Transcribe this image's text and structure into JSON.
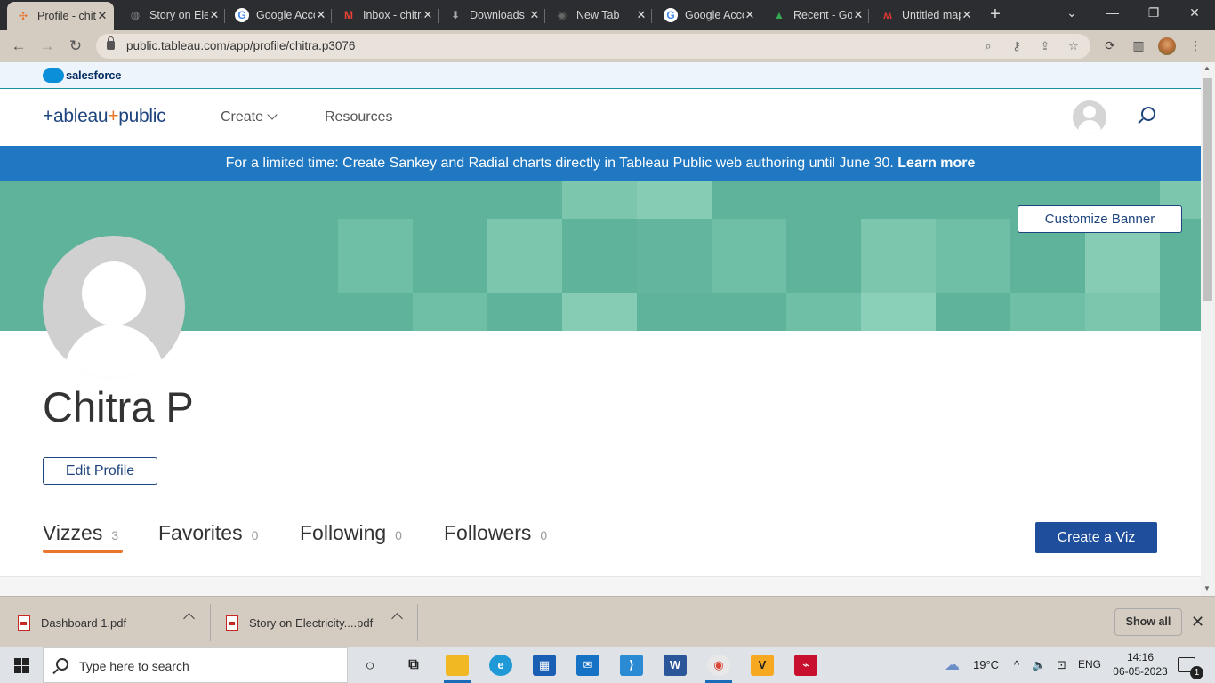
{
  "browser": {
    "tabs": [
      {
        "title": "Profile - chitra",
        "favicon": "tableau-icon",
        "active": true
      },
      {
        "title": "Story on Electricity",
        "favicon": "globe-icon"
      },
      {
        "title": "Google Account",
        "favicon": "google-icon"
      },
      {
        "title": "Inbox - chitra",
        "favicon": "gmail-icon"
      },
      {
        "title": "Downloads",
        "favicon": "download-icon"
      },
      {
        "title": "New Tab",
        "favicon": "chrome-icon"
      },
      {
        "title": "Google Account",
        "favicon": "google-icon"
      },
      {
        "title": "Recent - Google Drive",
        "favicon": "drive-icon"
      },
      {
        "title": "Untitled map",
        "favicon": "mapme-icon"
      }
    ],
    "url": "public.tableau.com/app/profile/chitra.p3076"
  },
  "salesforce": {
    "label": "salesforce"
  },
  "header": {
    "logo": {
      "pre": "+ableau",
      "plus": "+",
      "post": "public"
    },
    "nav": {
      "create": "Create",
      "resources": "Resources"
    }
  },
  "promo": {
    "text": "For a limited time: Create Sankey and Radial charts directly in Tableau Public web authoring until June 30.",
    "link": "Learn more"
  },
  "banner": {
    "customize": "Customize Banner"
  },
  "profile": {
    "name": "Chitra P",
    "edit": "Edit Profile",
    "tabs": [
      {
        "label": "Vizzes",
        "count": "3"
      },
      {
        "label": "Favorites",
        "count": "0"
      },
      {
        "label": "Following",
        "count": "0"
      },
      {
        "label": "Followers",
        "count": "0"
      }
    ],
    "create_viz": "Create a Viz"
  },
  "downloads": {
    "items": [
      "Dashboard 1.pdf",
      "Story on Electricity....pdf"
    ],
    "show_all": "Show all"
  },
  "taskbar": {
    "search_placeholder": "Type here to search",
    "weather": "19°C",
    "lang": "ENG",
    "time": "14:16",
    "date": "06-05-2023",
    "notifications": "1"
  },
  "colors": {
    "accent": "#e8762c",
    "brand": "#1f457e",
    "promo": "#1f78c1",
    "banner": "#5fb39b"
  }
}
